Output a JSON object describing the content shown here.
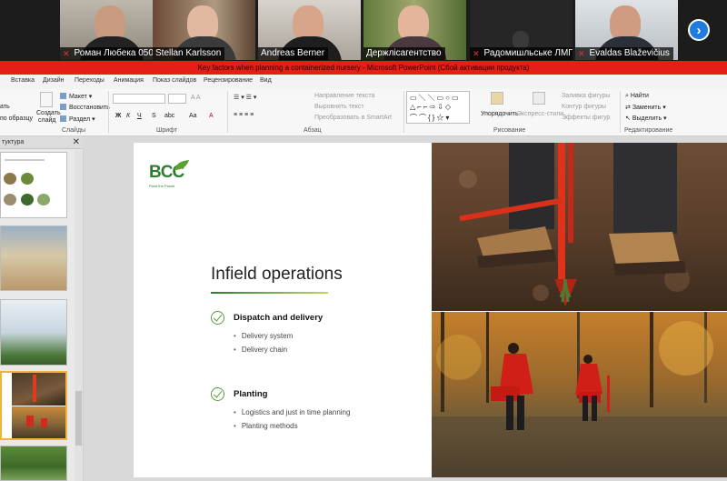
{
  "participants": [
    {
      "name": "Роман Любека 050-4...",
      "muted": true
    },
    {
      "name": "Stellan Karlsson",
      "muted": false
    },
    {
      "name": "Andreas Berner",
      "muted": false
    },
    {
      "name": "Держлісагентство",
      "muted": false
    },
    {
      "name": "Радомишльське ЛМГ",
      "muted": true
    },
    {
      "name": "Evaldas Blaževičius",
      "muted": true
    }
  ],
  "window_title": "Key factors when planning a containerized nursery - Microsoft PowerPoint (Сбой активации продукта)",
  "ribbon": {
    "tabs": [
      "Вставка",
      "Дизайн",
      "Переходы",
      "Анимация",
      "Показ слайдов",
      "Рецензирование",
      "Вид"
    ],
    "slides_group": {
      "paste_partial": "ать",
      "format_partial": "по образцу",
      "new_slide": "Создать",
      "new_slide_2": "слайд",
      "layout": "Макет",
      "reset": "Восстановить",
      "section": "Раздел",
      "label": "Слайды"
    },
    "font_group": {
      "label": "Шрифт",
      "bold": "Ж",
      "italic": "К",
      "underline": "Ч",
      "strike": "S",
      "spacing": "abc",
      "case": "Aa"
    },
    "paragraph_group": {
      "label": "Абзац",
      "text_direction": "Направление текста",
      "align_text": "Выровнять текст",
      "smartart": "Преобразовать в SmartArt"
    },
    "drawing_group": {
      "label": "Рисование",
      "arrange": "Упорядочить",
      "quick_styles": "Экспресс-стили",
      "fill": "Заливка фигуры",
      "outline": "Контур фигуры",
      "effects": "Эффекты фигур"
    },
    "editing_group": {
      "label": "Редактирование",
      "find": "Найти",
      "replace": "Заменить",
      "select": "Выделить"
    }
  },
  "outline_pane": {
    "title": "туктура"
  },
  "slide": {
    "logo_text": "BCC",
    "logo_tagline": "Plant the Planet",
    "title": "Infield operations",
    "sections": [
      {
        "heading": "Dispatch and delivery",
        "bullets": [
          "Delivery system",
          "Delivery chain"
        ]
      },
      {
        "heading": "Planting",
        "bullets": [
          "Logistics and  just in time planning",
          "Planting methods"
        ]
      }
    ]
  },
  "colors": {
    "title_bar": "#e42014",
    "accent_green": "#2e7d32",
    "selection": "#f0b43c",
    "next_button": "#1f7be0"
  }
}
